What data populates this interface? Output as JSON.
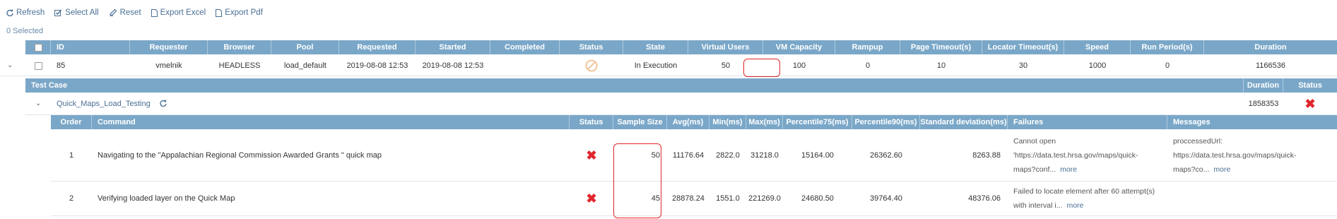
{
  "toolbar": {
    "refresh": "Refresh",
    "select_all": "Select All",
    "reset": "Reset",
    "export_excel": "Export Excel",
    "export_pdf": "Export Pdf"
  },
  "selection_status": "0 Selected",
  "grid": {
    "headers": [
      "ID",
      "Requester",
      "Browser",
      "Pool",
      "Requested",
      "Started",
      "Completed",
      "Status",
      "State",
      "Virtual Users",
      "VM Capacity",
      "Rampup",
      "Page Timeout(s)",
      "Locator Timeout(s)",
      "Speed",
      "Run Period(s)",
      "Duration"
    ],
    "row": {
      "id": "85",
      "requester": "vmelnik",
      "browser": "HEADLESS",
      "pool": "load_default",
      "requested": "2019-08-08 12:53",
      "started": "2019-08-08 12:53",
      "completed": "",
      "status_icon": "blocked-icon",
      "state": "In Execution",
      "virtual_users": "50",
      "vm_capacity": "100",
      "rampup": "0",
      "page_timeout": "10",
      "locator_timeout": "30",
      "speed": "1000",
      "run_period": "0",
      "duration": "1166536"
    }
  },
  "test_case": {
    "headers": {
      "test_case": "Test Case",
      "duration": "Duration",
      "status": "Status"
    },
    "name": "Quick_Maps_Load_Testing",
    "duration": "1858353",
    "status_icon": "fail-x-icon"
  },
  "commands": {
    "headers": [
      "Order",
      "Command",
      "Status",
      "Sample Size",
      "Avg(ms)",
      "Min(ms)",
      "Max(ms)",
      "Percentile75(ms)",
      "Percentile90(ms)",
      "Standard deviation(ms)",
      "Failures",
      "Messages"
    ],
    "rows": [
      {
        "order": "1",
        "command": "Navigating to the \"Appalachian Regional Commission Awarded Grants \" quick map",
        "status_icon": "fail-x-icon",
        "sample_size": "50",
        "avg": "11176.64",
        "min": "2822.0",
        "max": "31218.0",
        "p75": "15164.00",
        "p90": "26362.60",
        "stddev": "8263.88",
        "failures_l1": "Cannot open",
        "failures_l2": "'https://data.test.hrsa.gov/maps/quick-",
        "failures_l3": "maps?conf...",
        "failures_more": "more",
        "messages_l1": "proccessedUrl:",
        "messages_l2": "https://data.test.hrsa.gov/maps/quick-",
        "messages_l3": "maps?co...",
        "messages_more": "more"
      },
      {
        "order": "2",
        "command": "Verifying loaded layer on the Quick Map",
        "status_icon": "fail-x-icon",
        "sample_size": "45",
        "avg": "28878.24",
        "min": "1551.0",
        "max": "221269.0",
        "p75": "24680.50",
        "p90": "39764.40",
        "stddev": "48376.06",
        "failures_l1": "Failed to locate element after 60 attempt(s)",
        "failures_l2": "with interval i...",
        "failures_more": "more"
      }
    ]
  },
  "colors": {
    "header_bg": "#7aa7c8",
    "link": "#4a6f95",
    "error": "#e0262c",
    "status_warning": "#f0c090"
  }
}
